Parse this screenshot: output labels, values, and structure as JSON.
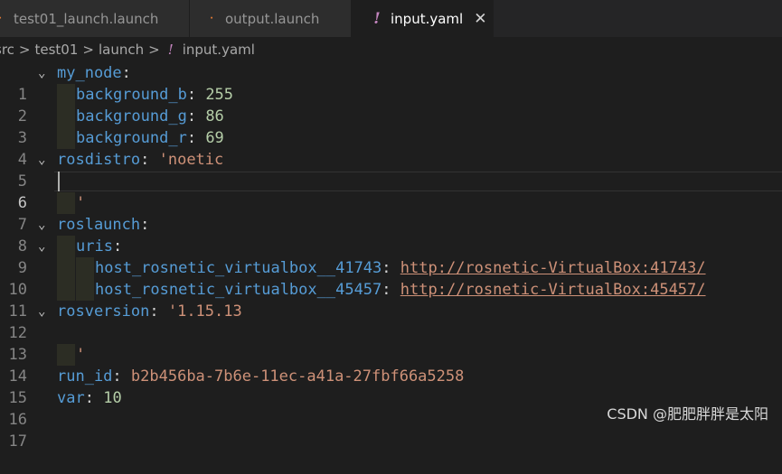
{
  "tabs": [
    {
      "label": "test01_launch.launch",
      "icon": "rss-icon"
    },
    {
      "label": "output.launch",
      "icon": "rss-icon"
    },
    {
      "label": "input.yaml",
      "icon": "yaml-exclaim-icon",
      "active": true,
      "close": "✕"
    }
  ],
  "breadcrumb": {
    "items": [
      "src",
      "test01",
      "launch",
      "input.yaml"
    ],
    "separator": ">",
    "yaml_icon": "!"
  },
  "editor": {
    "line_numbers": [
      "1",
      "2",
      "3",
      "4",
      "5",
      "6",
      "7",
      "8",
      "9",
      "10",
      "11",
      "12",
      "13",
      "14",
      "15",
      "16",
      "17"
    ],
    "lines": {
      "l1": {
        "key": "my_node",
        "colon": ":"
      },
      "l2": {
        "key": "background_b",
        "colon": ": ",
        "value": "255"
      },
      "l3": {
        "key": "background_g",
        "colon": ": ",
        "value": "86"
      },
      "l4": {
        "key": "background_r",
        "colon": ": ",
        "value": "69"
      },
      "l5": {
        "key": "rosdistro",
        "colon": ": ",
        "value": "'noetic"
      },
      "l7": {
        "value": "'"
      },
      "l8": {
        "key": "roslaunch",
        "colon": ":"
      },
      "l9": {
        "key": "uris",
        "colon": ":"
      },
      "l10": {
        "key": "host_rosnetic_virtualbox__41743",
        "colon": ": ",
        "value": "http://rosnetic-VirtualBox:41743/"
      },
      "l11": {
        "key": "host_rosnetic_virtualbox__45457",
        "colon": ": ",
        "value": "http://rosnetic-VirtualBox:45457/"
      },
      "l12": {
        "key": "rosversion",
        "colon": ": ",
        "value": "'1.15.13"
      },
      "l14": {
        "value": "'"
      },
      "l15": {
        "key": "run_id",
        "colon": ": ",
        "value": "b2b456ba-7b6e-11ec-a41a-27fbf66a5258"
      },
      "l16": {
        "key": "var",
        "colon": ": ",
        "value": "10"
      }
    },
    "fold_chevron": "⌄"
  },
  "watermark": "CSDN @肥肥胖胖是太阳"
}
